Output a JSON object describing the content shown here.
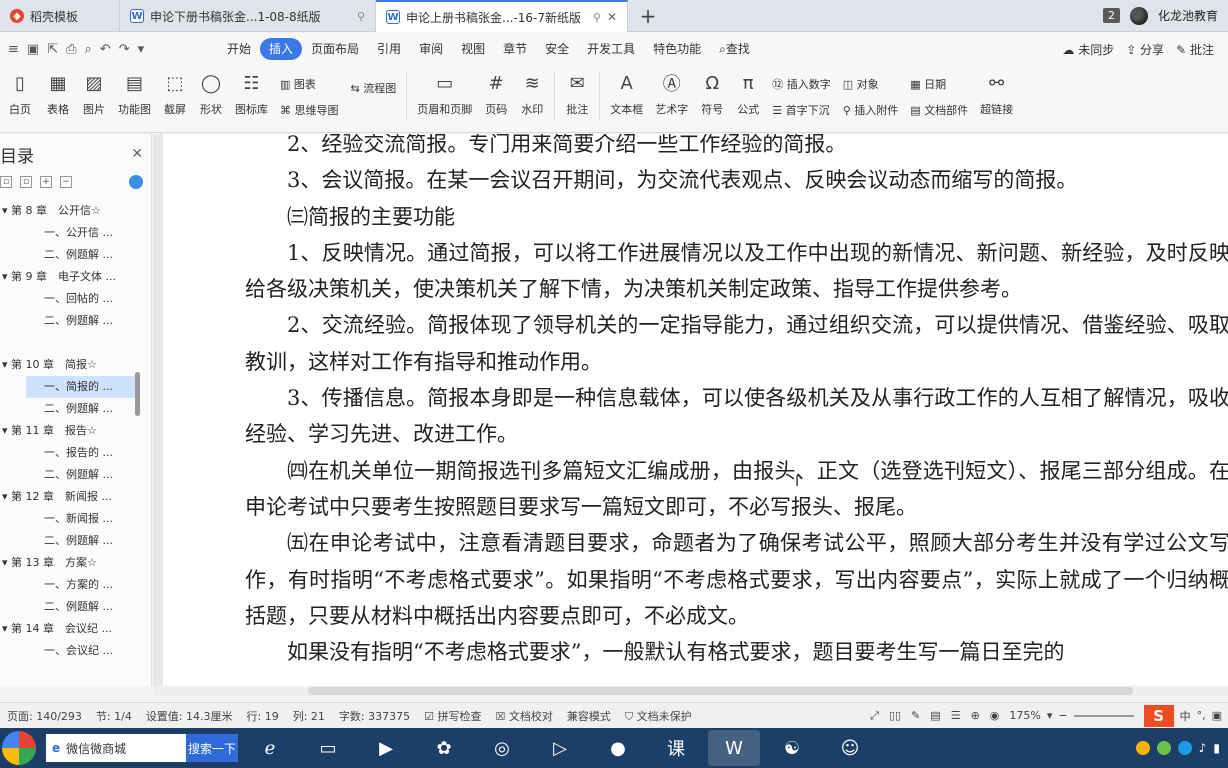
{
  "tabs": [
    {
      "label": "稻壳模板",
      "icon": "docer-icon"
    },
    {
      "label": "申论下册书稿张金...1-08-8纸版",
      "icon": "wps-writer-icon"
    },
    {
      "label": "申论上册书稿张金...-16-7新纸版",
      "icon": "wps-writer-icon"
    }
  ],
  "tabbar": {
    "count": "2",
    "user": "化龙池教育"
  },
  "menu": {
    "items": [
      "开始",
      "插入",
      "页面布局",
      "引用",
      "审阅",
      "视图",
      "章节",
      "安全",
      "开发工具",
      "特色功能",
      "查找"
    ],
    "active": "插入",
    "right": [
      "未同步",
      "分享",
      "批注"
    ]
  },
  "ribbon": {
    "big1": [
      "白页",
      "表格",
      "图片",
      "功能图",
      "截屏",
      "形状",
      "图标库"
    ],
    "col1": [
      "图表",
      "思维导图"
    ],
    "col2": [
      "流程图"
    ],
    "big2": [
      "页眉和页脚",
      "页码",
      "水印",
      "批注",
      "文本框",
      "艺术字",
      "符号",
      "公式"
    ],
    "col3": [
      "插入数字",
      "首字下沉"
    ],
    "col4": [
      "对象",
      "插入附件"
    ],
    "col5": [
      "日期",
      "文档部件"
    ],
    "big3": [
      "超链接"
    ]
  },
  "sidebar": {
    "title": "目录",
    "toc": [
      {
        "text": "第 8 章　公开信☆",
        "level": "ch"
      },
      {
        "text": "一、公开信 ...",
        "level": "sec"
      },
      {
        "text": "二、例题解 ...",
        "level": "sec"
      },
      {
        "text": "第 9 章　电子文体 ...",
        "level": "ch"
      },
      {
        "text": "一、回帖的 ...",
        "level": "sec"
      },
      {
        "text": "二、例题解 ...",
        "level": "sec"
      },
      {
        "text": "",
        "level": "sec"
      },
      {
        "text": "第 10 章　简报☆",
        "level": "ch"
      },
      {
        "text": "一、简报的 ...",
        "level": "sel"
      },
      {
        "text": "二、例题解 ...",
        "level": "sec"
      },
      {
        "text": "第 11 章　报告☆",
        "level": "ch"
      },
      {
        "text": "一、报告的 ...",
        "level": "sec"
      },
      {
        "text": "二、例题解 ...",
        "level": "sec"
      },
      {
        "text": "第 12 章　新闻报 ...",
        "level": "ch"
      },
      {
        "text": "一、新闻报 ...",
        "level": "sec"
      },
      {
        "text": "二、例题解 ...",
        "level": "sec"
      },
      {
        "text": "第 13 章　方案☆",
        "level": "ch"
      },
      {
        "text": "一、方案的 ...",
        "level": "sec"
      },
      {
        "text": "二、例题解 ...",
        "level": "sec"
      },
      {
        "text": "第 14 章　会议纪 ...",
        "level": "ch"
      },
      {
        "text": "一、会议纪 ...",
        "level": "sec"
      }
    ]
  },
  "document": {
    "paragraphs": [
      "2、经验交流简报。专门用来简要介绍一些工作经验的简报。",
      "3、会议简报。在某一会议召开期间，为交流代表观点、反映会议动态而缩写的简报。",
      "㈢简报的主要功能",
      "1、反映情况。通过简报，可以将工作进展情况以及工作中出现的新情况、新问题、新经验，及时反映给各级决策机关，使决策机关了解下情，为决策机关制定政策、指导工作提供参考。",
      "2、交流经验。简报体现了领导机关的一定指导能力，通过组织交流，可以提供情况、借鉴经验、吸取教训，这样对工作有指导和推动作用。",
      "3、传播信息。简报本身即是一种信息载体，可以使各级机关及从事行政工作的人互相了解情况，吸收经验、学习先进、改进工作。",
      "㈣在机关单位一期简报选刊多篇短文汇编成册，由报头、正文（选登选刊短文）、报尾三部分组成。在申论考试中只要考生按照题目要求写一篇短文即可，不必写报头、报尾。",
      "㈤在申论考试中，注意看清题目要求，命题者为了确保考试公平，照顾大部分考生并没有学过公文写作，有时指明“不考虑格式要求”。如果指明“不考虑格式要求，写出内容要点”，实际上就成了一个归纳概括题，只要从材料中概括出内容要点即可，不必成文。",
      "如果没有指明“不考虑格式要求”，一般默认有格式要求，题目要考生写一篇日至完的"
    ]
  },
  "status": {
    "page": "页面: 140/293",
    "section": "节: 1/4",
    "setting": "设置值: 14.3厘米",
    "row": "行: 19",
    "col": "列: 21",
    "words": "字数: 337375",
    "spell": "拼写检查",
    "proof": "文档校对",
    "compat": "兼容模式",
    "protect": "文档未保护",
    "zoom": "175%"
  },
  "taskbar": {
    "search_text": "微信微商城",
    "search_button": "搜索一下",
    "app_label": "课"
  },
  "colors": {
    "accent": "#3b78e7",
    "taskbar": "#1d3e66",
    "selected_toc": "#cfe2fb"
  }
}
